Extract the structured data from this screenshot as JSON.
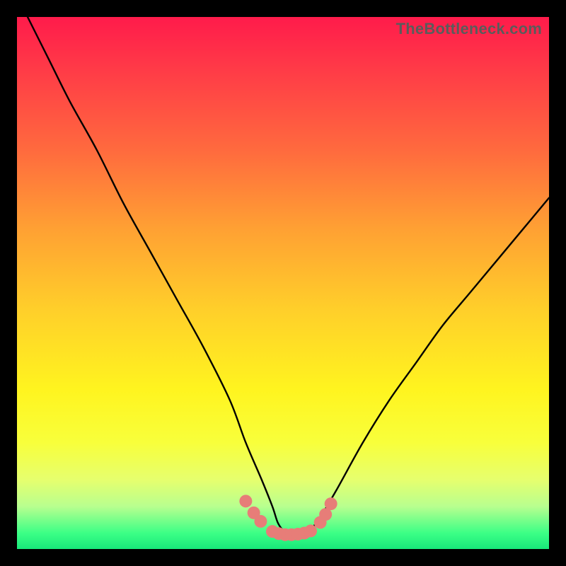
{
  "watermark": "TheBottleneck.com",
  "chart_data": {
    "type": "line",
    "title": "",
    "xlabel": "",
    "ylabel": "",
    "xlim": [
      0,
      100
    ],
    "ylim": [
      0,
      100
    ],
    "series": [
      {
        "name": "bottleneck-curve",
        "x": [
          2,
          6,
          10,
          15,
          20,
          25,
          30,
          35,
          40,
          43,
          46,
          48,
          49,
          50,
          51,
          52,
          53,
          55,
          57,
          60,
          65,
          70,
          75,
          80,
          85,
          90,
          95,
          100
        ],
        "values": [
          100,
          92,
          84,
          75,
          65,
          56,
          47,
          38,
          28,
          20,
          13,
          8,
          5,
          3.5,
          2.6,
          2.5,
          2.6,
          3.5,
          6,
          11,
          20,
          28,
          35,
          42,
          48,
          54,
          60,
          66
        ]
      }
    ],
    "markers": [
      {
        "name": "left-cluster",
        "points": [
          {
            "x": 43.0,
            "y": 9.0
          },
          {
            "x": 44.5,
            "y": 6.8
          },
          {
            "x": 45.8,
            "y": 5.2
          }
        ]
      },
      {
        "name": "bottom-band",
        "points": [
          {
            "x": 48.0,
            "y": 3.3
          },
          {
            "x": 49.2,
            "y": 2.9
          },
          {
            "x": 50.4,
            "y": 2.7
          },
          {
            "x": 51.6,
            "y": 2.7
          },
          {
            "x": 52.8,
            "y": 2.8
          },
          {
            "x": 54.0,
            "y": 3.0
          },
          {
            "x": 55.2,
            "y": 3.4
          }
        ]
      },
      {
        "name": "right-cluster",
        "points": [
          {
            "x": 57.0,
            "y": 5.0
          },
          {
            "x": 58.0,
            "y": 6.5
          },
          {
            "x": 59.0,
            "y": 8.5
          }
        ]
      }
    ],
    "marker_style": {
      "color": "#e77d78",
      "radius_px": 9
    }
  }
}
